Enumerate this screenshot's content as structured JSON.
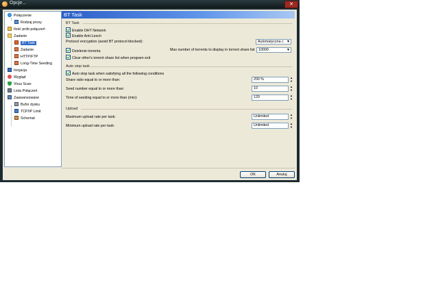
{
  "window": {
    "title": "Opcje..."
  },
  "tree": {
    "items": [
      {
        "label": "Połączenie",
        "icon": "globe-icon"
      },
      {
        "label": "Rodzaj proxy",
        "icon": "computer-icon"
      },
      {
        "label": "Ilość prób połączeń",
        "icon": "folder-icon"
      },
      {
        "label": "Zadanie",
        "icon": "folder-open-icon"
      },
      {
        "label": "BT Task",
        "icon": "bt-task-icon"
      },
      {
        "label": "Zadanie",
        "icon": "task-icon"
      },
      {
        "label": "HTTP/FTP",
        "icon": "task-icon"
      },
      {
        "label": "Long-Time Seeding",
        "icon": "task-icon"
      },
      {
        "label": "Inicjacja",
        "icon": "init-icon"
      },
      {
        "label": "Wygląd",
        "icon": "appearance-icon"
      },
      {
        "label": "Virus Scan",
        "icon": "shield-icon"
      },
      {
        "label": "Lista Połączeń",
        "icon": "list-icon"
      },
      {
        "label": "Zaawansowane",
        "icon": "advanced-icon"
      },
      {
        "label": "Bufor dysku",
        "icon": "disk-icon"
      },
      {
        "label": "TCP/IP Limit",
        "icon": "network-icon"
      },
      {
        "label": "Schemat",
        "icon": "scheme-icon"
      }
    ]
  },
  "panel": {
    "header": "BT Task",
    "bt_group": {
      "title": "BT Task",
      "enable_dht": "Enable DHT Network",
      "enable_antileech": "Enable Anti-Leech",
      "encryption_label": "Protocol encryption (avoid BT protocol blocked):",
      "encryption_value": "Automatyczna c",
      "dzielenie": "Dzielenie torrenta",
      "max_torrents_label": "Max number of torrents to display in torrent share list",
      "max_torrents_value": "10000",
      "clear_list": "Clear other's torrent share list when program exit"
    },
    "auto_stop": {
      "title": "Auto stop task",
      "checkbox": "Auto stop task when satisfying all the following conditions",
      "share_ratio_label": "Share ratio equal to or more than:",
      "share_ratio_value": "200 %",
      "seed_number_label": "Seed number equal to or more than:",
      "seed_number_value": "10",
      "seeding_time_label": "Time of seeding equal to or more than (min):",
      "seeding_time_value": "120"
    },
    "upload": {
      "title": "Upload",
      "max_rate_label": "Maximum upload rate per task:",
      "max_rate_value": "Unlimited",
      "min_rate_label": "Minimum upload rate per task:",
      "min_rate_value": "Unlimited"
    }
  },
  "buttons": {
    "ok": "OK",
    "cancel": "Anuluj"
  }
}
